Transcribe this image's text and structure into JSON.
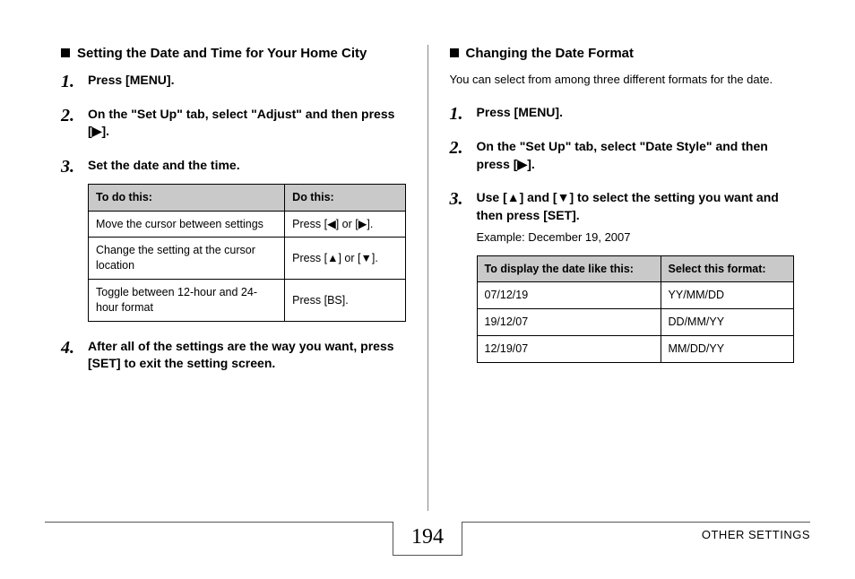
{
  "left": {
    "heading": "Setting the Date and Time for Your Home City",
    "steps": {
      "s1": "Press [MENU].",
      "s2_a": "On the \"Set Up\" tab, select \"Adjust\" and then press [",
      "s2_b": "].",
      "s3": "Set the date and the time.",
      "s4": "After all of the settings are the way you want, press [SET] to exit the setting screen."
    },
    "table": {
      "h1": "To do this:",
      "h2": "Do this:",
      "r1c1": "Move the cursor between settings",
      "r1c2_a": "Press [",
      "r1c2_b": "] or [",
      "r1c2_c": "].",
      "r2c1": "Change the setting at the cursor location",
      "r2c2_a": "Press [",
      "r2c2_b": "] or [",
      "r2c2_c": "].",
      "r3c1": "Toggle between 12-hour and 24-hour format",
      "r3c2": "Press [BS]."
    }
  },
  "right": {
    "heading": "Changing the Date Format",
    "intro": "You can select from among three different formats for the date.",
    "steps": {
      "s1": "Press [MENU].",
      "s2_a": "On the \"Set Up\" tab, select \"Date Style\" and then press [",
      "s2_b": "].",
      "s3_a": "Use [",
      "s3_b": "] and [",
      "s3_c": "] to select the setting you want and then press [SET].",
      "example": "Example: December 19, 2007"
    },
    "table": {
      "h1": "To display the date like this:",
      "h2": "Select this format:",
      "r1c1": "07/12/19",
      "r1c2": "YY/MM/DD",
      "r2c1": "19/12/07",
      "r2c2": "DD/MM/YY",
      "r3c1": "12/19/07",
      "r3c2": "MM/DD/YY"
    }
  },
  "footer": {
    "page": "194",
    "section": "OTHER SETTINGS"
  },
  "glyphs": {
    "right": "▶",
    "left": "◀",
    "up": "▲",
    "down": "▼"
  }
}
